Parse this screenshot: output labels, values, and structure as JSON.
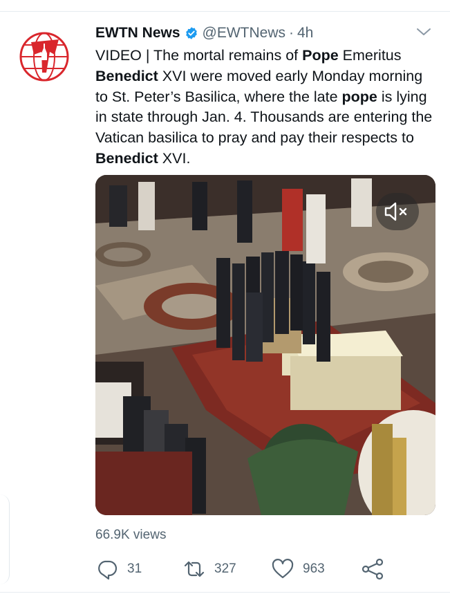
{
  "tweet": {
    "author_name": "EWTN News",
    "handle": "@EWTNews",
    "separator": "·",
    "time": "4h",
    "text_segments": [
      {
        "t": "VIDEO | The mortal remains of ",
        "b": false
      },
      {
        "t": "Pope",
        "b": true
      },
      {
        "t": " Emeritus ",
        "b": false
      },
      {
        "t": "Benedict",
        "b": true
      },
      {
        "t": " XVI were moved early Monday morning to St. Peter’s Basilica, where the late ",
        "b": false
      },
      {
        "t": "pope",
        "b": true
      },
      {
        "t": " is lying in state through Jan. 4. Thousands are entering the Vatican basilica to pray and pay their respects to ",
        "b": false
      },
      {
        "t": "Benedict",
        "b": true
      },
      {
        "t": " XVI.",
        "b": false
      }
    ],
    "views": "66.9K views",
    "reply_count": "31",
    "retweet_count": "327",
    "like_count": "963"
  },
  "icons": {
    "avatar": "ewtn-logo",
    "verified": "verified-badge-icon",
    "more": "chevron-down-icon",
    "mute": "speaker-muted-icon",
    "reply": "reply-icon",
    "retweet": "retweet-icon",
    "like": "heart-icon",
    "share": "share-icon"
  },
  "colors": {
    "text": "#0f1419",
    "secondary": "#536471",
    "verified": "#1d9bf0",
    "ewtn_red": "#d9262c"
  }
}
